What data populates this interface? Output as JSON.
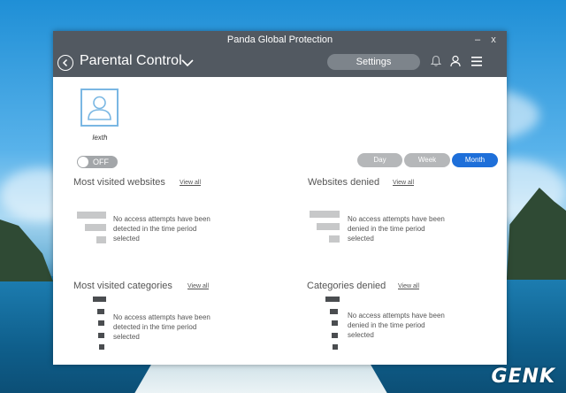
{
  "window": {
    "title": "Panda Global Protection",
    "minimize_label": "–",
    "close_label": "x"
  },
  "header": {
    "title": "Parental Control",
    "settings_label": "Settings",
    "icons": [
      "back-icon",
      "chevron-down-icon",
      "bell-icon",
      "user-icon",
      "menu-icon"
    ]
  },
  "profile": {
    "username": "lexth"
  },
  "toggle": {
    "label": "OFF"
  },
  "period": {
    "day": "Day",
    "week": "Week",
    "month": "Month",
    "selected": "Month"
  },
  "sections": {
    "most_visited_websites": {
      "title": "Most visited websites",
      "view_all": "View all",
      "empty": "No access attempts have been detected in the time period selected"
    },
    "websites_denied": {
      "title": "Websites denied",
      "view_all": "View all",
      "empty": "No access attempts have been denied in the time period selected"
    },
    "most_visited_categories": {
      "title": "Most visited categories",
      "view_all": "View all",
      "empty": "No access attempts have been detected in the time period selected"
    },
    "categories_denied": {
      "title": "Categories denied",
      "view_all": "View all",
      "empty": "No access attempts have been denied in the time period selected"
    }
  },
  "colors": {
    "header_bg": "#525961",
    "accent": "#1e6fd9",
    "avatar_border": "#7ab7e3"
  },
  "watermark": "GENK"
}
